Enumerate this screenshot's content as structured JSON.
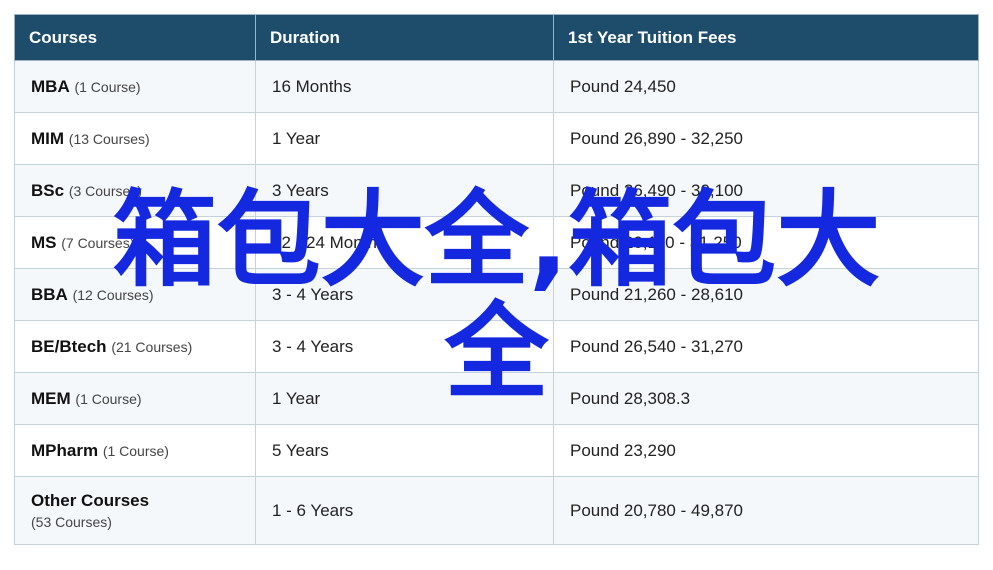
{
  "table": {
    "headers": [
      "Courses",
      "Duration",
      "1st Year Tuition Fees"
    ],
    "rows": [
      {
        "name": "MBA",
        "count": "(1 Course)",
        "duration": "16 Months",
        "fee": "Pound 24,450"
      },
      {
        "name": "MIM",
        "count": "(13 Courses)",
        "duration": "1 Year",
        "fee": "Pound 26,890 - 32,250"
      },
      {
        "name": "BSc",
        "count": "(3 Courses)",
        "duration": "3 Years",
        "fee": "Pound 26,490 - 30,100"
      },
      {
        "name": "MS",
        "count": "(7 Courses)",
        "duration": "12 - 24 Months",
        "fee": "Pound 20,110 - 31,250"
      },
      {
        "name": "BBA",
        "count": "(12 Courses)",
        "duration": "3 - 4 Years",
        "fee": "Pound 21,260 - 28,610"
      },
      {
        "name": "BE/Btech",
        "count": "(21 Courses)",
        "duration": "3 - 4 Years",
        "fee": "Pound 26,540 - 31,270"
      },
      {
        "name": "MEM",
        "count": "(1 Course)",
        "duration": "1 Year",
        "fee": "Pound 28,308.3"
      },
      {
        "name": "MPharm",
        "count": "(1 Course)",
        "duration": "5 Years",
        "fee": "Pound 23,290"
      },
      {
        "name": "Other Courses",
        "count": "(53 Courses)",
        "duration": "1 - 6 Years",
        "fee": "Pound 20,780 - 49,870"
      }
    ]
  },
  "overlay": {
    "line1": "箱包大全,箱包大",
    "line2": "全",
    "color": "#1428e0"
  },
  "colors": {
    "header_bg": "#1e4d6b",
    "row_alt_bg": "#f4f8fb"
  }
}
